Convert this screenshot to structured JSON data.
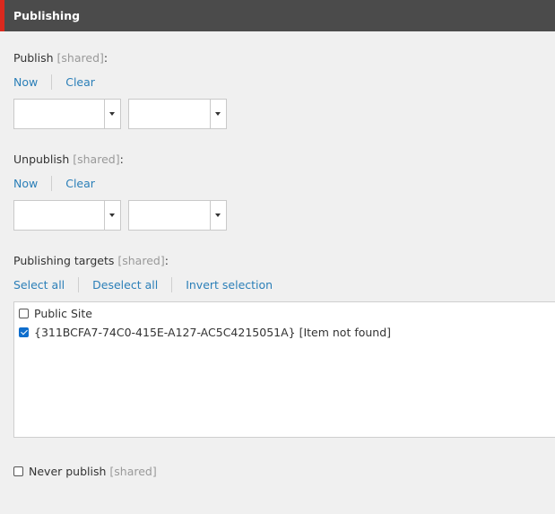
{
  "header": {
    "title": "Publishing"
  },
  "publish": {
    "label": "Publish",
    "shared_tag": "[shared]",
    "colon": ":",
    "now_label": "Now",
    "clear_label": "Clear",
    "date_value": "",
    "time_value": ""
  },
  "unpublish": {
    "label": "Unpublish",
    "shared_tag": "[shared]",
    "colon": ":",
    "now_label": "Now",
    "clear_label": "Clear",
    "date_value": "",
    "time_value": ""
  },
  "targets": {
    "label": "Publishing targets",
    "shared_tag": "[shared]",
    "colon": ":",
    "select_all": "Select all",
    "deselect_all": "Deselect all",
    "invert_selection": "Invert selection",
    "items": [
      {
        "label": "Public Site",
        "checked": false
      },
      {
        "label": "{311BCFA7-74C0-415E-A127-AC5C4215051A} [Item not found]",
        "checked": true
      }
    ]
  },
  "never_publish": {
    "label": "Never publish",
    "shared_tag": "[shared]",
    "checked": false
  },
  "colors": {
    "accent": "#dc291e",
    "header_bg": "#4b4b4b",
    "link": "#2b7fb8",
    "checkbox_checked": "#0f6ecd"
  }
}
